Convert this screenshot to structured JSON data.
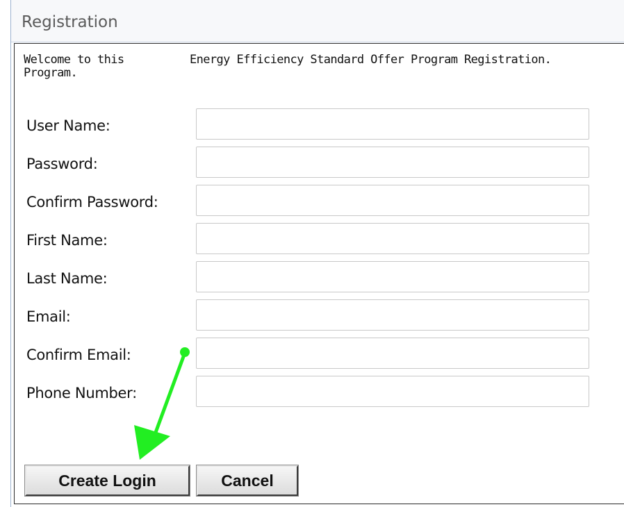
{
  "panel": {
    "title": "Registration"
  },
  "intro": {
    "welcome": "Welcome to this Program.",
    "program_title": "Energy Efficiency Standard Offer Program Registration."
  },
  "fields": [
    {
      "label": "User Name:",
      "value": ""
    },
    {
      "label": "Password:",
      "value": ""
    },
    {
      "label": "Confirm Password:",
      "value": ""
    },
    {
      "label": "First Name:",
      "value": ""
    },
    {
      "label": "Last Name:",
      "value": ""
    },
    {
      "label": "Email:",
      "value": ""
    },
    {
      "label": "Confirm Email:",
      "value": ""
    },
    {
      "label": "Phone Number:",
      "value": ""
    }
  ],
  "buttons": {
    "create_label": "Create Login",
    "cancel_label": "Cancel"
  },
  "annotation": {
    "arrow_color": "#22ee22",
    "points_to": "create-login-button"
  }
}
